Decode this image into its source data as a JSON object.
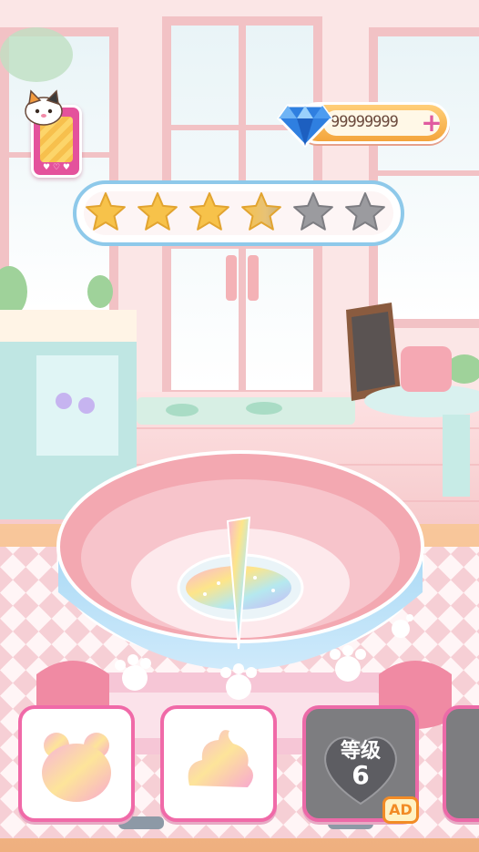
{
  "hud": {
    "gems": "99999999",
    "gem_plus": "+",
    "phone_hearts": "♥ ♡ ♥"
  },
  "stars": {
    "total": 6,
    "filled": 3,
    "partial_fill": 0.6
  },
  "trays": [
    {
      "name": "bear-shape-tray",
      "state": "unlocked"
    },
    {
      "name": "swirl-shape-tray",
      "state": "unlocked"
    },
    {
      "name": "locked-tray",
      "state": "locked",
      "level_label": "等级",
      "level_value": "6",
      "badge": "AD"
    },
    {
      "name": "partial-tray",
      "state": "locked"
    }
  ],
  "icons": [
    "diamond-icon",
    "plus-icon",
    "phone-icon",
    "cat-icon",
    "star-icon",
    "heart-icon",
    "bear-icon",
    "swirl-icon",
    "paw-icon",
    "ad-badge"
  ],
  "colors": {
    "star_filled": "#f7c24a",
    "star_empty": "#9b9b9f",
    "bowl_blue": "#bfe2f7",
    "accent_pink": "#f06aa8",
    "gem_blue": "#3b8ee8"
  }
}
